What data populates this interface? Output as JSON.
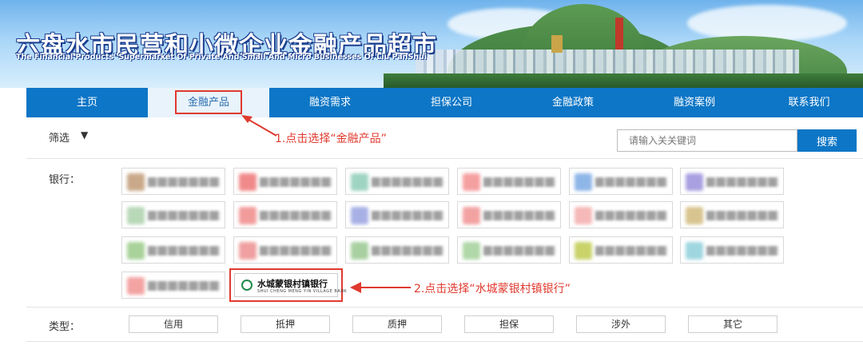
{
  "header": {
    "title": "六盘水市民营和小微企业金融产品超市",
    "subtitle": "The Financial Products' Supermarket Of Private And Small And Micro Businesses Of Liu PanShui"
  },
  "nav": {
    "items": [
      "主页",
      "金融产品",
      "融资需求",
      "担保公司",
      "金融政策",
      "融资案例",
      "联系我们"
    ],
    "active": "金融产品"
  },
  "filter": {
    "label": "筛选",
    "arrow": "▼"
  },
  "search": {
    "placeholder": "请输入关关键词",
    "button": "搜索"
  },
  "banks": {
    "label": "银行：",
    "visible_bank_name": "水城蒙银村镇银行",
    "visible_bank_english": "SHUI CHENG MENG YIN VILLAGE BANK"
  },
  "types": {
    "label": "类型：",
    "items": [
      "信用",
      "抵押",
      "质押",
      "担保",
      "涉外",
      "其它"
    ]
  },
  "annotations": {
    "step1": "1.点击选择“金融产品”",
    "step2": "2.点击选择“水城蒙银村镇银行”"
  },
  "colors": {
    "nav_bg": "#0d76c6",
    "highlight": "#e03a2f",
    "active_tab_bg": "#e9f3fb"
  }
}
